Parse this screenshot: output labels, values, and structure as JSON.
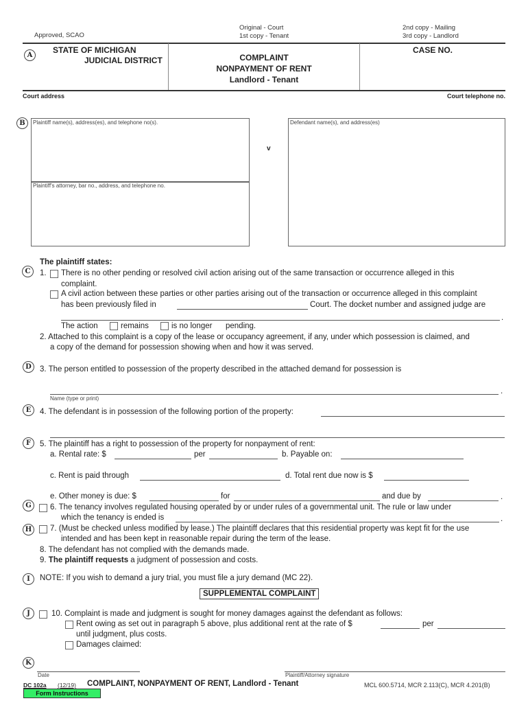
{
  "header": {
    "approved": "Approved, SCAO",
    "copies_left": [
      "Original - Court",
      "1st copy - Tenant"
    ],
    "copies_right": [
      "2nd copy - Mailing",
      "3rd copy - Landlord"
    ],
    "state": "STATE OF MICHIGAN",
    "district": "JUDICIAL DISTRICT",
    "title_line1": "COMPLAINT",
    "title_line2": "NONPAYMENT OF RENT",
    "title_line3": "Landlord - Tenant",
    "case_no": "CASE NO.",
    "court_address": "Court address",
    "court_telephone": "Court telephone no."
  },
  "markers": [
    "A",
    "B",
    "C",
    "D",
    "E",
    "F",
    "G",
    "H",
    "I",
    "J",
    "K"
  ],
  "parties": {
    "plaintiff_label": "Plaintiff name(s), address(es), and telephone no(s).",
    "attorney_label": "Plaintiff's attorney, bar no., address, and telephone no.",
    "versus": "v",
    "defendant_label": "Defendant name(s), and address(es)"
  },
  "statements": {
    "heading": "The plaintiff states:",
    "s1_num": "1.",
    "s1a_line1": "There is no other pending or resolved civil action arising out of the same transaction or occurrence alleged in this",
    "s1a_line2": "complaint.",
    "s1b_line1": "A civil action between these parties or other parties arising out of the transaction or occurrence alleged in this complaint",
    "s1b_line2_pre": "has been previously filed in",
    "s1b_line2_post": "Court.  The docket number and assigned judge are",
    "action_pre": "The action",
    "remains": "remains",
    "no_longer": "is no longer",
    "pending": "pending.",
    "s2_line1": "2. Attached to this complaint is a copy of the lease or occupancy agreement, if any, under which possession is claimed, and",
    "s2_line2": "a copy of the demand for possession showing when and how it was served.",
    "s3": "3. The person entitled to possession of the property described in the attached demand for possession is",
    "name_caption": "Name (type or print)",
    "s4": "4. The defendant is in possession of the following portion of the property:",
    "s5": "5. The plaintiff has a right to possession of the property for nonpayment of rent:",
    "s5a": "a. Rental rate: $",
    "s5a_per": "per",
    "s5b": "b. Payable on:",
    "s5c": "c. Rent is paid through",
    "s5d": "d. Total rent due now is $",
    "s5e": "e. Other money is due:  $",
    "s5e_for": "for",
    "s5e_due": "and due by",
    "s6_line1": "6. The tenancy involves regulated housing operated by or under rules of a governmental unit.  The rule or law under",
    "s6_line2": "which the tenancy is ended is",
    "s7_line1": "7. (Must be checked unless modified by lease.)  The plaintiff declares that this residential property was kept fit for the use",
    "s7_line2": "intended and has been kept in reasonable repair during the term of the lease.",
    "s8": "8. The defendant has not complied with the demands made.",
    "s9_num": "9.",
    "s9_bold": "The plaintiff requests",
    "s9_rest": "a judgment of possession and costs.",
    "note": "NOTE:  If you wish to demand a jury trial, you must file a jury demand (MC 22)."
  },
  "supplemental": {
    "heading": "SUPPLEMENTAL COMPLAINT",
    "s10": "10. Complaint is made and judgment is sought for money damages against the defendant as follows:",
    "rent_owing": "Rent owing as set out in paragraph 5 above, plus additional rent at the rate of $",
    "rent_per": "per",
    "rent_until": "until judgment, plus costs.",
    "damages": "Damages claimed:"
  },
  "signature": {
    "date_caption": "Date",
    "signature_caption": "Plaintiff/Attorney signature"
  },
  "footer": {
    "form_id": "DC 102a",
    "revision": "(12/19)",
    "form_title": "COMPLAINT, NONPAYMENT OF RENT, Landlord - Tenant",
    "citations": "MCL 600.5714, MCR 2.113(C), MCR 4.201(B)",
    "instructions_button": "Form Instructions",
    "instructions_color": "#33ee66"
  }
}
